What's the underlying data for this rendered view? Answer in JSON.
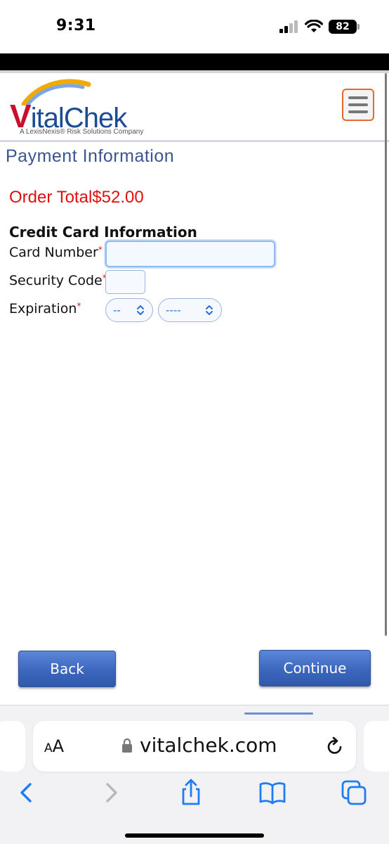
{
  "status_bar": {
    "time": "9:31",
    "battery": "82"
  },
  "header": {
    "logo_text_v": "V",
    "logo_text_rest": "italChek",
    "logo_tagline": "A LexisNexis® Risk Solutions Company",
    "menu_icon": "hamburger-icon",
    "menu_border_color": "#e36a2b"
  },
  "page": {
    "title": "Payment Information",
    "order_total_label": "Order Total",
    "order_total_value": "$52.00",
    "section_title": "Credit Card Information",
    "required_mark": "*",
    "fields": {
      "card_number_label": "Card Number",
      "card_number_value": "",
      "security_code_label": "Security Code",
      "security_code_value": "",
      "expiration_label": "Expiration",
      "exp_month_selected": "--",
      "exp_year_selected": "----"
    },
    "buttons": {
      "back": "Back",
      "continue": "Continue"
    },
    "colors": {
      "title": "#3b5591",
      "order_total": "#e01010",
      "button": "#3c67bd"
    }
  },
  "safari": {
    "aa_label_big": "A",
    "aa_label_small": "A",
    "url": "vitalchek.com",
    "icons": [
      "lock-icon",
      "reload-icon",
      "back-icon",
      "forward-icon",
      "share-icon",
      "bookmarks-icon",
      "tabs-icon"
    ],
    "accent": "#1f7cf2"
  }
}
